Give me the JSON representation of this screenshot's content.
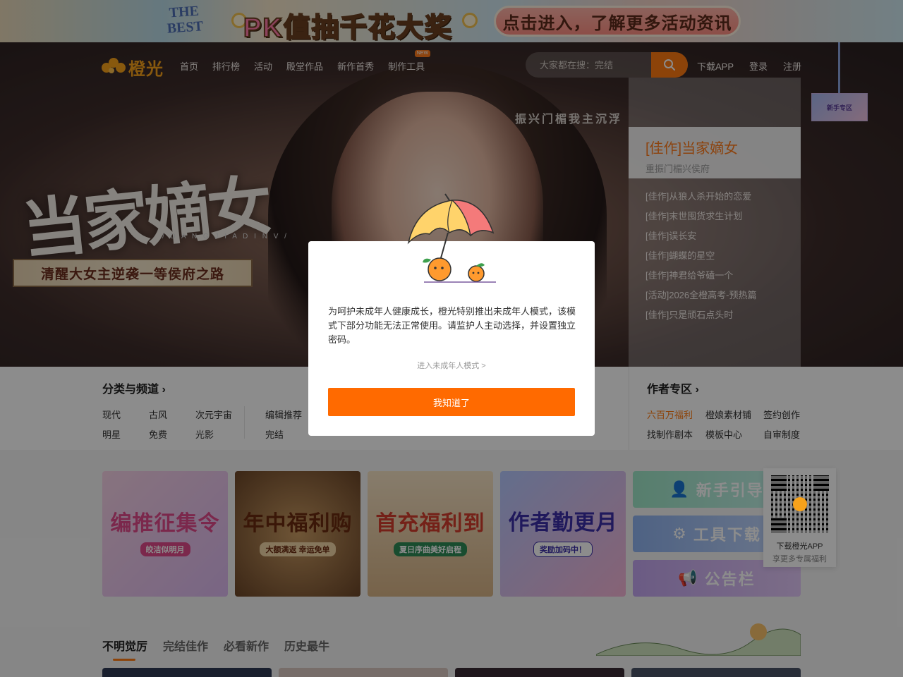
{
  "top_banner": {
    "best_line1": "THE",
    "best_line2": "BEST",
    "title": "PK值抽千花大奖",
    "cta": "点击进入，了解更多活动资讯"
  },
  "hero": {
    "title": "当家嫡女",
    "subtitle_en": "/ D A N G J I A D I N V /",
    "ribbon": "清醒大女主逆袭一等侯府之路",
    "vertical_text": "振兴门楣我主沉浮"
  },
  "header": {
    "logo_text": "橙光",
    "nav": [
      {
        "label": "首页"
      },
      {
        "label": "排行榜"
      },
      {
        "label": "活动"
      },
      {
        "label": "殿堂作品"
      },
      {
        "label": "新作首秀"
      },
      {
        "label": "制作工具",
        "badge": "NEW"
      }
    ],
    "search_placeholder": "大家都在搜：完结",
    "user_links": [
      "下载APP",
      "登录",
      "注册"
    ]
  },
  "hero_list": {
    "featured_title": "[佳作]当家嫡女",
    "featured_sub": "重振门楣兴侯府",
    "items": [
      "[佳作]从狼人杀开始的恋爱",
      "[佳作]末世囤货求生计划",
      "[佳作]误长安",
      "[佳作]蝴蝶的星空",
      "[佳作]神君给爷磕一个",
      "[活动]2026全橙高考-预热篇",
      "[佳作]只是顽石点头时"
    ]
  },
  "side_ad": "新手专区",
  "categories": {
    "title": "分类与频道",
    "row1": [
      "现代",
      "古风",
      "次元宇宙"
    ],
    "row2": [
      "明星",
      "免费",
      "光影"
    ],
    "col2_row1": "编辑推荐",
    "col2_row2": "完结"
  },
  "author": {
    "title": "作者专区",
    "row1": [
      "六百万福利",
      "橙娘素材铺",
      "签约创作"
    ],
    "row2": [
      "找制作剧本",
      "模板中心",
      "自审制度"
    ],
    "highlight_color": "#ff7a12"
  },
  "promos": [
    {
      "big": "编推征集令",
      "small": "皎洁似明月"
    },
    {
      "big": "年中福利购",
      "small": "大额满返 幸运免单"
    },
    {
      "big": "首充福利到",
      "small": "夏日序曲美好启程"
    },
    {
      "big": "作者勤更月",
      "small": "奖励加码中！"
    }
  ],
  "side_banners": [
    {
      "label": "新手引导",
      "icon": "user-guide-icon"
    },
    {
      "label": "工具下载",
      "icon": "gear-icon"
    },
    {
      "label": "公告栏",
      "icon": "megaphone-icon"
    }
  ],
  "qr": {
    "title": "下载橙光APP",
    "sub": "享更多专属福利"
  },
  "tabs": [
    "不明觉厉",
    "完结佳作",
    "必看新作",
    "历史最牛"
  ],
  "modal": {
    "text": "为呵护未成年人健康成长，橙光特别推出未成年人模式，该模式下部分功能无法正常使用。请监护人主动选择，并设置独立密码。",
    "link": "进入未成年人模式 >",
    "button": "我知道了"
  },
  "colors": {
    "accent": "#ff6a00",
    "brand": "#f7a21b"
  }
}
